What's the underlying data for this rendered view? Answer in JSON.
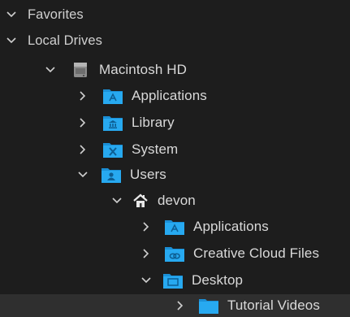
{
  "sections": {
    "favorites": {
      "label": "Favorites"
    },
    "local_drives": {
      "label": "Local Drives"
    }
  },
  "tree": {
    "drive": {
      "label": "Macintosh HD",
      "icon": "hard-drive-icon"
    },
    "drive_children": [
      {
        "label": "Applications",
        "icon": "applications-folder-icon",
        "expanded": false
      },
      {
        "label": "Library",
        "icon": "library-folder-icon",
        "expanded": false
      },
      {
        "label": "System",
        "icon": "system-folder-icon",
        "expanded": false
      },
      {
        "label": "Users",
        "icon": "users-folder-icon",
        "expanded": true
      }
    ],
    "user": {
      "label": "devon",
      "icon": "home-icon"
    },
    "user_children": [
      {
        "label": "Applications",
        "icon": "applications-folder-icon",
        "expanded": false
      },
      {
        "label": "Creative Cloud Files",
        "icon": "creative-cloud-folder-icon",
        "expanded": false
      },
      {
        "label": "Desktop",
        "icon": "desktop-folder-icon",
        "expanded": true
      }
    ],
    "desktop_children": [
      {
        "label": "Tutorial Videos",
        "icon": "folder-icon",
        "expanded": false
      }
    ]
  },
  "colors": {
    "background": "#1d1d1d",
    "selected_row": "#2f2f2f",
    "folder_blue": "#1da1f2",
    "text": "#d9d9d9"
  }
}
